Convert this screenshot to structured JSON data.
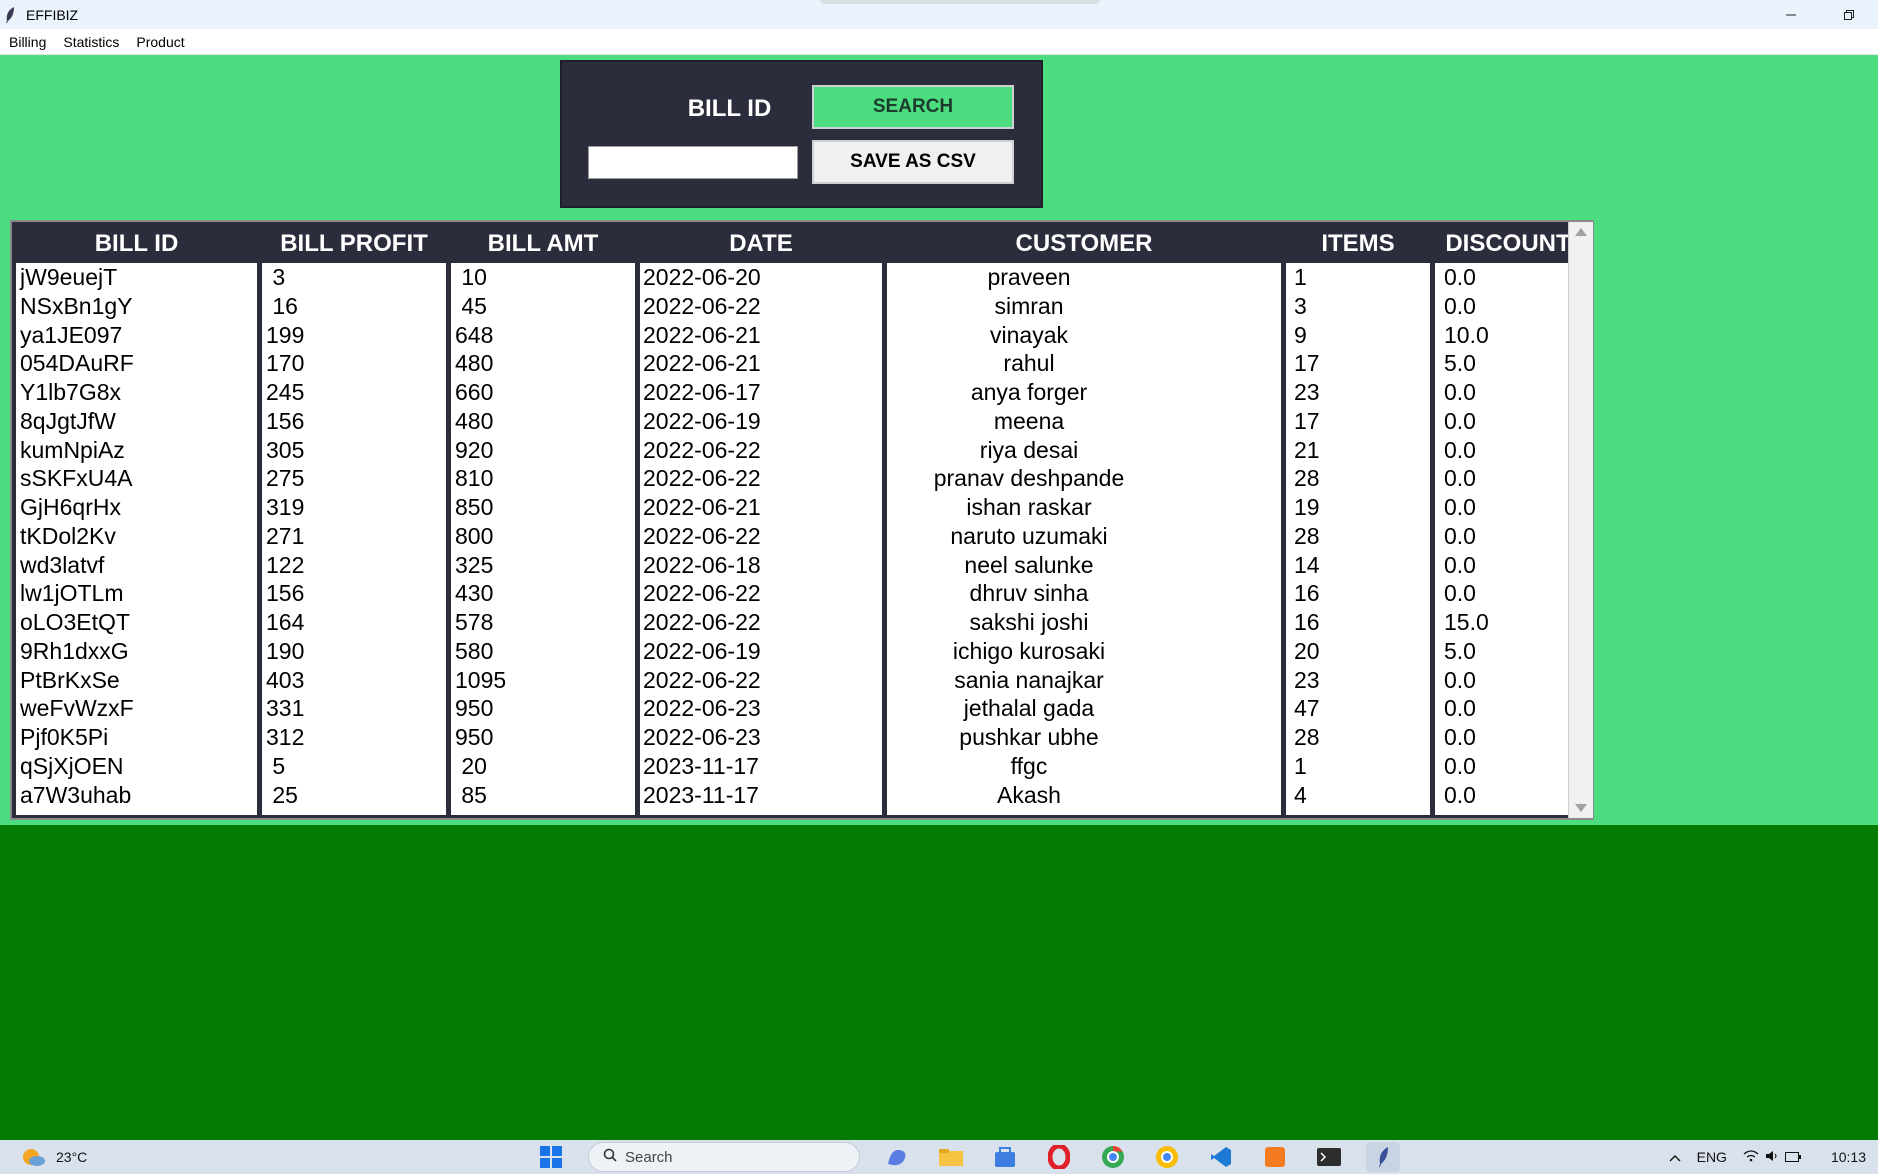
{
  "window": {
    "title": "EFFIBIZ",
    "minimize_icon": "minimize-icon",
    "restore_icon": "restore-icon"
  },
  "menu": {
    "items": [
      "Billing",
      "Statistics",
      "Product"
    ]
  },
  "search_panel": {
    "label": "BILL ID",
    "search_label": "SEARCH",
    "csv_label": "SAVE AS CSV",
    "input_value": ""
  },
  "table": {
    "columns": [
      "BILL ID",
      "BILL PROFIT",
      "BILL AMT",
      "DATE",
      "CUSTOMER",
      "ITEMS",
      "DISCOUNT"
    ],
    "rows": [
      [
        "jW9euejT",
        " 3",
        " 10",
        "2022-06-20",
        "praveen",
        "1",
        "0.0"
      ],
      [
        "NSxBn1gY",
        " 16",
        " 45",
        "2022-06-22",
        "simran",
        "3",
        "0.0"
      ],
      [
        "ya1JE097",
        "199",
        "648",
        "2022-06-21",
        "vinayak",
        "9",
        "10.0"
      ],
      [
        "054DAuRF",
        "170",
        "480",
        "2022-06-21",
        "rahul",
        "17",
        "5.0"
      ],
      [
        "Y1lb7G8x",
        "245",
        "660",
        "2022-06-17",
        "anya forger",
        "23",
        "0.0"
      ],
      [
        "8qJgtJfW",
        "156",
        "480",
        "2022-06-19",
        "meena",
        "17",
        "0.0"
      ],
      [
        "kumNpiAz",
        "305",
        "920",
        "2022-06-22",
        "riya desai",
        "21",
        "0.0"
      ],
      [
        "sSKFxU4A",
        "275",
        "810",
        "2022-06-22",
        "pranav deshpande",
        "28",
        "0.0"
      ],
      [
        "GjH6qrHx",
        "319",
        "850",
        "2022-06-21",
        "ishan raskar",
        "19",
        "0.0"
      ],
      [
        "tKDol2Kv",
        "271",
        "800",
        "2022-06-22",
        "naruto uzumaki",
        "28",
        "0.0"
      ],
      [
        "wd3latvf",
        "122",
        "325",
        "2022-06-18",
        "neel salunke",
        "14",
        "0.0"
      ],
      [
        "lw1jOTLm",
        "156",
        "430",
        "2022-06-22",
        "dhruv sinha",
        "16",
        "0.0"
      ],
      [
        "oLO3EtQT",
        "164",
        "578",
        "2022-06-22",
        "sakshi joshi",
        "16",
        "15.0"
      ],
      [
        "9Rh1dxxG",
        "190",
        "580",
        "2022-06-19",
        "ichigo kurosaki",
        "20",
        "5.0"
      ],
      [
        "PtBrKxSe",
        "403",
        "1095",
        "2022-06-22",
        "sania nanajkar",
        "23",
        "0.0"
      ],
      [
        "weFvWzxF",
        "331",
        "950",
        "2022-06-23",
        "jethalal gada",
        "47",
        "0.0"
      ],
      [
        "Pjf0K5Pi",
        "312",
        "950",
        "2022-06-23",
        "pushkar ubhe",
        "28",
        "0.0"
      ],
      [
        "qSjXjOEN",
        " 5",
        " 20",
        "2023-11-17",
        "ffgc",
        "1",
        "0.0"
      ],
      [
        "a7W3uhab",
        " 25",
        " 85",
        "2023-11-17",
        "Akash",
        "4",
        "0.0"
      ]
    ]
  },
  "taskbar": {
    "weather": "23°C",
    "search_placeholder": "Search",
    "lang": "ENG",
    "time": "10:13"
  },
  "colors": {
    "main_bg": "#4cdd80",
    "lower_bg": "#037b03",
    "panel_bg": "#2c2d3c",
    "search_button_bg": "#4cdd80"
  }
}
